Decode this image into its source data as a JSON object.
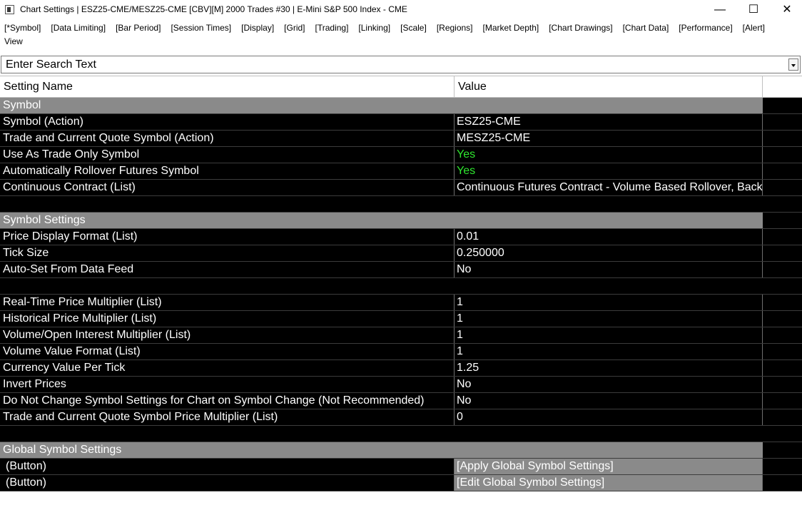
{
  "window": {
    "title": "Chart Settings | ESZ25-CME/MESZ25-CME [CBV][M]  2000 Trades #30 | E-Mini S&P 500 Index - CME",
    "minimize": "—",
    "maximize": "☐",
    "close": "✕"
  },
  "menu": {
    "tabs": [
      "[*Symbol]",
      "[Data Limiting]",
      "[Bar Period]",
      "[Session Times]",
      "[Display]",
      "[Grid]",
      "[Trading]",
      "[Linking]",
      "[Scale]",
      "[Regions]",
      "[Market Depth]",
      "[Chart Drawings]",
      "[Chart Data]",
      "[Performance]",
      "[Alert]"
    ],
    "second_row": "View"
  },
  "search": {
    "placeholder": "Enter Search Text"
  },
  "table": {
    "col_name": "Setting Name",
    "col_value": "Value",
    "rows": [
      {
        "kind": "section",
        "name": "Symbol",
        "value": ""
      },
      {
        "kind": "item",
        "name": "Symbol (Action)",
        "value": "ESZ25-CME"
      },
      {
        "kind": "item",
        "name": "Trade and Current Quote Symbol (Action)",
        "value": "MESZ25-CME"
      },
      {
        "kind": "item",
        "name": "Use As Trade Only Symbol",
        "value": "Yes",
        "green": true
      },
      {
        "kind": "item",
        "name": "Automatically Rollover Futures Symbol",
        "value": "Yes",
        "green": true
      },
      {
        "kind": "item",
        "name": "Continuous Contract (List)",
        "value": "Continuous Futures Contract - Volume Based Rollover, Back Adjusted"
      },
      {
        "kind": "spacer",
        "name": "",
        "value": ""
      },
      {
        "kind": "section",
        "name": "Symbol Settings",
        "value": ""
      },
      {
        "kind": "item",
        "name": "Price Display Format (List)",
        "value": "0.01"
      },
      {
        "kind": "item",
        "name": "Tick Size",
        "value": "0.250000"
      },
      {
        "kind": "item",
        "name": "Auto-Set From Data Feed",
        "value": "No"
      },
      {
        "kind": "spacer",
        "name": "",
        "value": ""
      },
      {
        "kind": "item",
        "name": "Real-Time Price Multiplier (List)",
        "value": "1"
      },
      {
        "kind": "item",
        "name": "Historical Price Multiplier (List)",
        "value": "1"
      },
      {
        "kind": "item",
        "name": "Volume/Open Interest Multiplier (List)",
        "value": "1"
      },
      {
        "kind": "item",
        "name": "Volume Value Format (List)",
        "value": "1"
      },
      {
        "kind": "item",
        "name": "Currency Value Per Tick",
        "value": "1.25"
      },
      {
        "kind": "item",
        "name": "Invert Prices",
        "value": "No"
      },
      {
        "kind": "item",
        "name": "Do Not Change Symbol Settings for Chart on Symbol Change (Not Recommended)",
        "value": "No"
      },
      {
        "kind": "item",
        "name": "Trade and Current Quote Symbol Price Multiplier (List)",
        "value": "0"
      },
      {
        "kind": "spacer",
        "name": "",
        "value": ""
      },
      {
        "kind": "section",
        "name": "Global Symbol Settings",
        "value": ""
      },
      {
        "kind": "button",
        "name": "(Button)",
        "value": "[Apply Global Symbol Settings]"
      },
      {
        "kind": "button",
        "name": "(Button)",
        "value": "[Edit Global Symbol Settings]"
      }
    ]
  },
  "colors": {
    "grid_bg": "#000000",
    "section_bg": "#8a8a8a",
    "yes_green": "#2fe62f",
    "text": "#ffffff"
  }
}
